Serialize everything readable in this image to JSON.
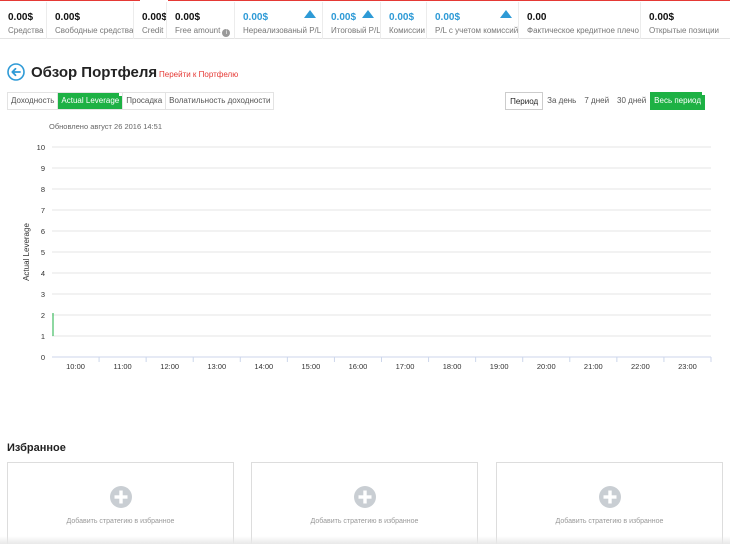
{
  "stats": [
    {
      "value": "0.00$",
      "label": "Средства",
      "blue": false,
      "arrow": false,
      "info": false
    },
    {
      "value": "0.00$",
      "label": "Свободные средства",
      "blue": false,
      "arrow": false,
      "info": false
    },
    {
      "value": "0.00$",
      "label": "Credit",
      "blue": false,
      "arrow": false,
      "info": false
    },
    {
      "value": "0.00$",
      "label": "Free amount",
      "blue": false,
      "arrow": false,
      "info": true
    },
    {
      "value": "0.00$",
      "label": "Нереализованый P/L",
      "blue": true,
      "arrow": true,
      "info": false
    },
    {
      "value": "0.00$",
      "label": "Итоговый P/L",
      "blue": true,
      "arrow": true,
      "info": false
    },
    {
      "value": "0.00$",
      "label": "Комиссии",
      "blue": true,
      "arrow": false,
      "info": false
    },
    {
      "value": "0.00$",
      "label": "P/L с учетом комиссий",
      "blue": true,
      "arrow": true,
      "info": false
    },
    {
      "value": "0.00",
      "label": "Фактическое кредитное плечо",
      "blue": false,
      "arrow": false,
      "info": false
    },
    {
      "value": "0.00$",
      "label": "Открытые позиции",
      "blue": false,
      "arrow": false,
      "info": false
    }
  ],
  "header": {
    "title": "Обзор Портфеля",
    "portfolio_link": "Перейти к Портфелю"
  },
  "tabs": [
    {
      "label": "Доходность",
      "active": false
    },
    {
      "label": "Actual Leverage",
      "active": true
    },
    {
      "label": "Просадка",
      "active": false
    },
    {
      "label": "Волатильность доходности",
      "active": false
    }
  ],
  "period": {
    "label": "Период",
    "options": [
      {
        "label": "За день",
        "active": false
      },
      {
        "label": "7 дней",
        "active": false
      },
      {
        "label": "30 дней",
        "active": false
      },
      {
        "label": "Весь период",
        "active": true
      }
    ]
  },
  "updated": "Обновлено август 26 2016 14:51",
  "chart_data": {
    "type": "line",
    "title": "",
    "ylabel": "Actual Leverage",
    "xlabel": "",
    "ylim": [
      0,
      10
    ],
    "yticks": [
      "0",
      "1",
      "2",
      "3",
      "4",
      "5",
      "6",
      "7",
      "8",
      "9",
      "10"
    ],
    "categories": [
      "10:00",
      "11:00",
      "12:00",
      "13:00",
      "14:00",
      "15:00",
      "16:00",
      "17:00",
      "18:00",
      "19:00",
      "20:00",
      "21:00",
      "22:00",
      "23:00"
    ],
    "series": [],
    "grid": true,
    "line_color": "#1db144"
  },
  "favorites": {
    "title": "Избранное",
    "cards": [
      {
        "label": "Добавить стратегию в избранное"
      },
      {
        "label": "Добавить стратегию в избранное"
      },
      {
        "label": "Добавить стратегию в избранное"
      }
    ]
  },
  "colors": {
    "accent_green": "#1db144",
    "link_red": "#e53935",
    "value_blue": "#2e9ad6"
  }
}
